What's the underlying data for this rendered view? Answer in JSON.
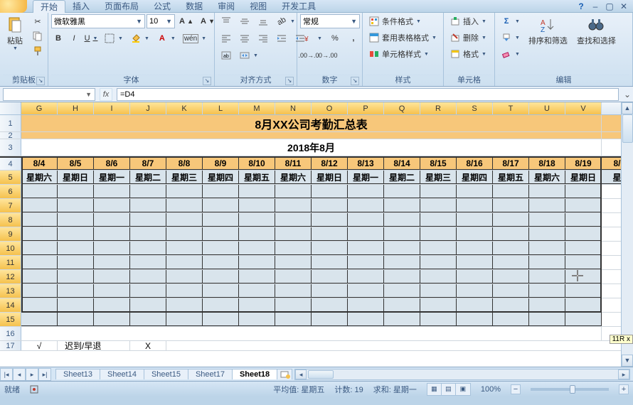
{
  "tabs": {
    "t0": "开始",
    "t1": "插入",
    "t2": "页面布局",
    "t3": "公式",
    "t4": "数据",
    "t5": "审阅",
    "t6": "视图",
    "t7": "开发工具"
  },
  "ribbon": {
    "clipboard": {
      "paste": "粘贴",
      "cut": "",
      "copy": "",
      "painter": "",
      "label": "剪贴板"
    },
    "font": {
      "name": "微软雅黑",
      "size": "10",
      "boldB": "B",
      "italicI": "I",
      "underlineU": "U",
      "label": "字体"
    },
    "align": {
      "label": "对齐方式"
    },
    "number": {
      "format": "常规",
      "label": "数字"
    },
    "styles": {
      "cond": "条件格式",
      "tablef": "套用表格格式",
      "cellf": "单元格样式",
      "label": "样式"
    },
    "cells": {
      "insert": "插入",
      "delete": "删除",
      "format": "格式",
      "label": "单元格"
    },
    "edit": {
      "sort": "排序和筛选",
      "find": "查找和选择",
      "label": "编辑"
    }
  },
  "formula_bar": {
    "namebox": "",
    "fx": "fx",
    "formula": "=D4"
  },
  "chart_data": {
    "type": "table",
    "title": "8月XX公司考勤汇总表",
    "subtitle": "2018年8月",
    "columns": [
      "G",
      "H",
      "I",
      "J",
      "K",
      "L",
      "M",
      "N",
      "O",
      "P",
      "Q",
      "R",
      "S",
      "T",
      "U",
      "V"
    ],
    "dates": [
      "8/4",
      "8/5",
      "8/6",
      "8/7",
      "8/8",
      "8/9",
      "8/10",
      "8/11",
      "8/12",
      "8/13",
      "8/14",
      "8/15",
      "8/16",
      "8/17",
      "8/18",
      "8/19",
      "8/"
    ],
    "dows": [
      "星期六",
      "星期日",
      "星期一",
      "星期二",
      "星期三",
      "星期四",
      "星期五",
      "星期六",
      "星期日",
      "星期一",
      "星期二",
      "星期三",
      "星期四",
      "星期五",
      "星期六",
      "星期日",
      "星"
    ],
    "data_rows": 10,
    "row17": {
      "check": "√",
      "label": "迟到/早退",
      "x": "X"
    }
  },
  "sheet_tabs": {
    "s0": "Sheet13",
    "s1": "Sheet14",
    "s2": "Sheet15",
    "s3": "Sheet17",
    "s4": "Sheet18"
  },
  "statusbar": {
    "ready": "就绪",
    "avg": "平均值: 星期五",
    "count": "计数: 19",
    "sum": "求和: 星期一",
    "zoom": "100%",
    "tag": "11R x"
  },
  "zoom_plus": "+",
  "zoom_minus": "−"
}
